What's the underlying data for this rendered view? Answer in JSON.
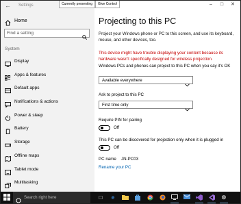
{
  "app": {
    "title": "Settings"
  },
  "sidebar": {
    "home_label": "Home",
    "search_placeholder": "Find a setting",
    "section_label": "System",
    "items": [
      {
        "label": "Display",
        "icon": "display-icon"
      },
      {
        "label": "Apps & features",
        "icon": "apps-icon"
      },
      {
        "label": "Default apps",
        "icon": "default-apps-icon"
      },
      {
        "label": "Notifications & actions",
        "icon": "notifications-icon"
      },
      {
        "label": "Power & sleep",
        "icon": "power-icon"
      },
      {
        "label": "Battery",
        "icon": "battery-icon"
      },
      {
        "label": "Storage",
        "icon": "storage-icon"
      },
      {
        "label": "Offline maps",
        "icon": "maps-icon"
      },
      {
        "label": "Tablet mode",
        "icon": "tablet-icon"
      },
      {
        "label": "Multitasking",
        "icon": "multitasking-icon"
      }
    ]
  },
  "remote_strip": {
    "presenting_label": "Currently presenting",
    "control_label": "Give Control"
  },
  "main": {
    "title": "Projecting to this PC",
    "description": "Project your Windows phone or PC to this screen, and use its keyboard, mouse, and other devices, too.",
    "warning": "This device might have trouble displaying your content because its hardware wasn't specifically designed for wireless projection.",
    "question1": "Windows PCs and phones can project to this PC when you say it's OK",
    "dropdown1_value": "Available everywhere",
    "question2": "Ask to project to this PC",
    "dropdown2_value": "First time only",
    "pin_label": "Require PIN for pairing",
    "pin_state": "Off",
    "plugged_label": "This PC can be discovered for projection only when it is plugged in",
    "plugged_state": "Off",
    "pc_name_label": "PC name",
    "pc_name_value": "JN-PC03",
    "rename_link": "Rename your PC"
  },
  "taskbar": {
    "search_text": "Search right here",
    "apps": [
      {
        "name": "task-view-icon",
        "color": "#ffffff"
      },
      {
        "name": "edge-icon",
        "color": "#3c8ad8"
      },
      {
        "name": "file-explorer-icon",
        "color": "#f2c94c"
      },
      {
        "name": "store-icon",
        "color": "#5aa0e0"
      },
      {
        "name": "chrome-icon",
        "color": "#e0463a"
      },
      {
        "name": "firefox-icon",
        "color": "#f08a24"
      },
      {
        "name": "remote-icon",
        "color": "#dadada"
      },
      {
        "name": "mail-icon",
        "color": "#4a90d9"
      },
      {
        "name": "visual-studio-icon",
        "color": "#8e5ccc"
      },
      {
        "name": "vs-code-icon",
        "color": "#9b6fd6"
      },
      {
        "name": "settings-icon",
        "color": "#cfcfcf"
      }
    ]
  },
  "colors": {
    "accent": "#0063b1",
    "warning": "#c50000",
    "sidebar_bg": "#f2f2f2",
    "taskbar_bg": "#101010"
  }
}
